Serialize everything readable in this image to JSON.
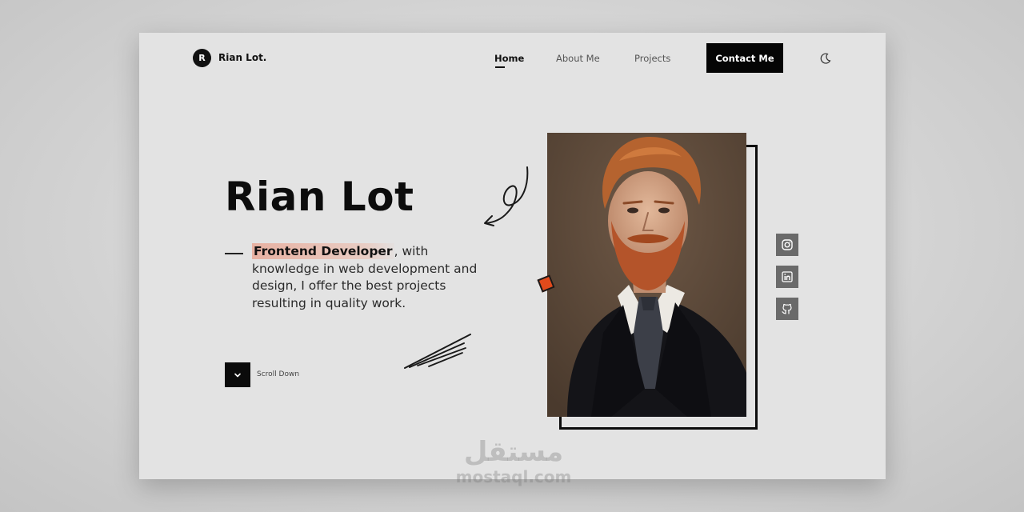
{
  "brand": {
    "initial": "R",
    "name": "Rian Lot."
  },
  "nav": {
    "items": [
      {
        "label": "Home",
        "active": true
      },
      {
        "label": "About Me",
        "active": false
      },
      {
        "label": "Projects",
        "active": false
      }
    ],
    "contact_label": "Contact Me",
    "theme_icon": "moon-icon"
  },
  "hero": {
    "name": "Rian Lot",
    "role": "Frontend Developer",
    "description": ", with knowledge in web development and design, I offer the best projects resulting in quality work.",
    "scroll_label": "Scroll Down"
  },
  "social": [
    {
      "icon": "instagram-icon"
    },
    {
      "icon": "linkedin-icon"
    },
    {
      "icon": "github-icon"
    }
  ],
  "watermark": {
    "arabic": "مستقل",
    "latin": "mostaql.com"
  },
  "colors": {
    "accent": "#e24a1b",
    "highlight": "#e8a896",
    "dark": "#0b0b0b",
    "panel": "#e3e3e3"
  }
}
